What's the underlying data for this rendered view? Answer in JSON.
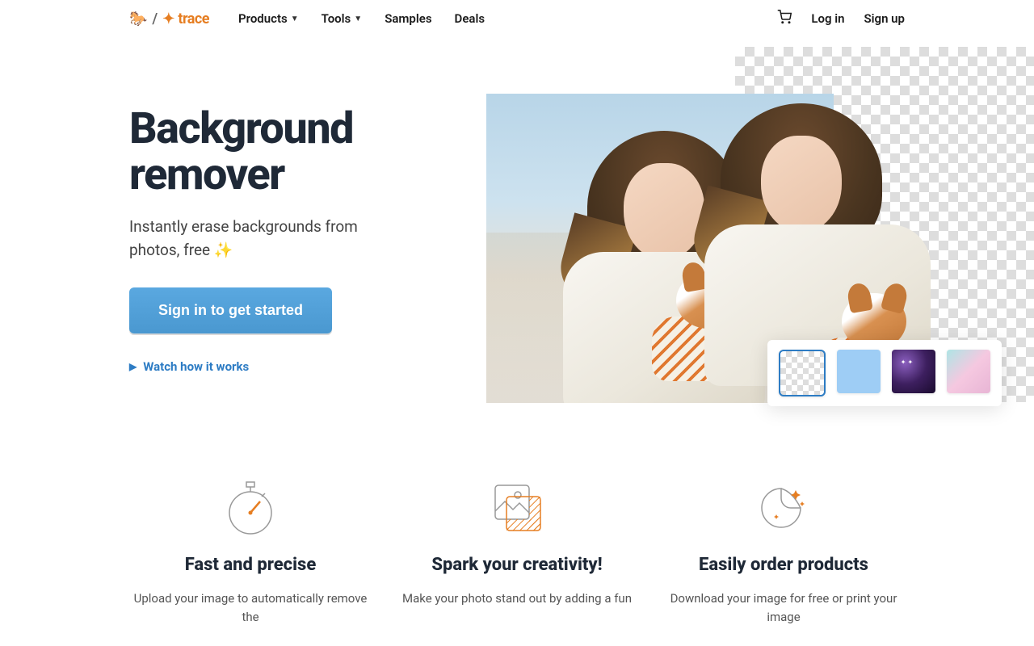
{
  "brand": {
    "name": "trace"
  },
  "nav": {
    "products": "Products",
    "tools": "Tools",
    "samples": "Samples",
    "deals": "Deals"
  },
  "auth": {
    "login": "Log in",
    "signup": "Sign up"
  },
  "hero": {
    "title": "Background remover",
    "subtitle": "Instantly erase backgrounds from photos, free ✨",
    "cta": "Sign in to get started",
    "watch": "Watch how it works"
  },
  "bg_options": {
    "transparent": "transparent",
    "blue": "solid-blue",
    "galaxy": "galaxy",
    "pastel": "pastel"
  },
  "features": [
    {
      "title": "Fast and precise",
      "desc": "Upload your image to automatically remove the"
    },
    {
      "title": "Spark your creativity!",
      "desc": "Make your photo stand out by adding a fun"
    },
    {
      "title": "Easily order products",
      "desc": "Download your image for free or print your image"
    }
  ]
}
